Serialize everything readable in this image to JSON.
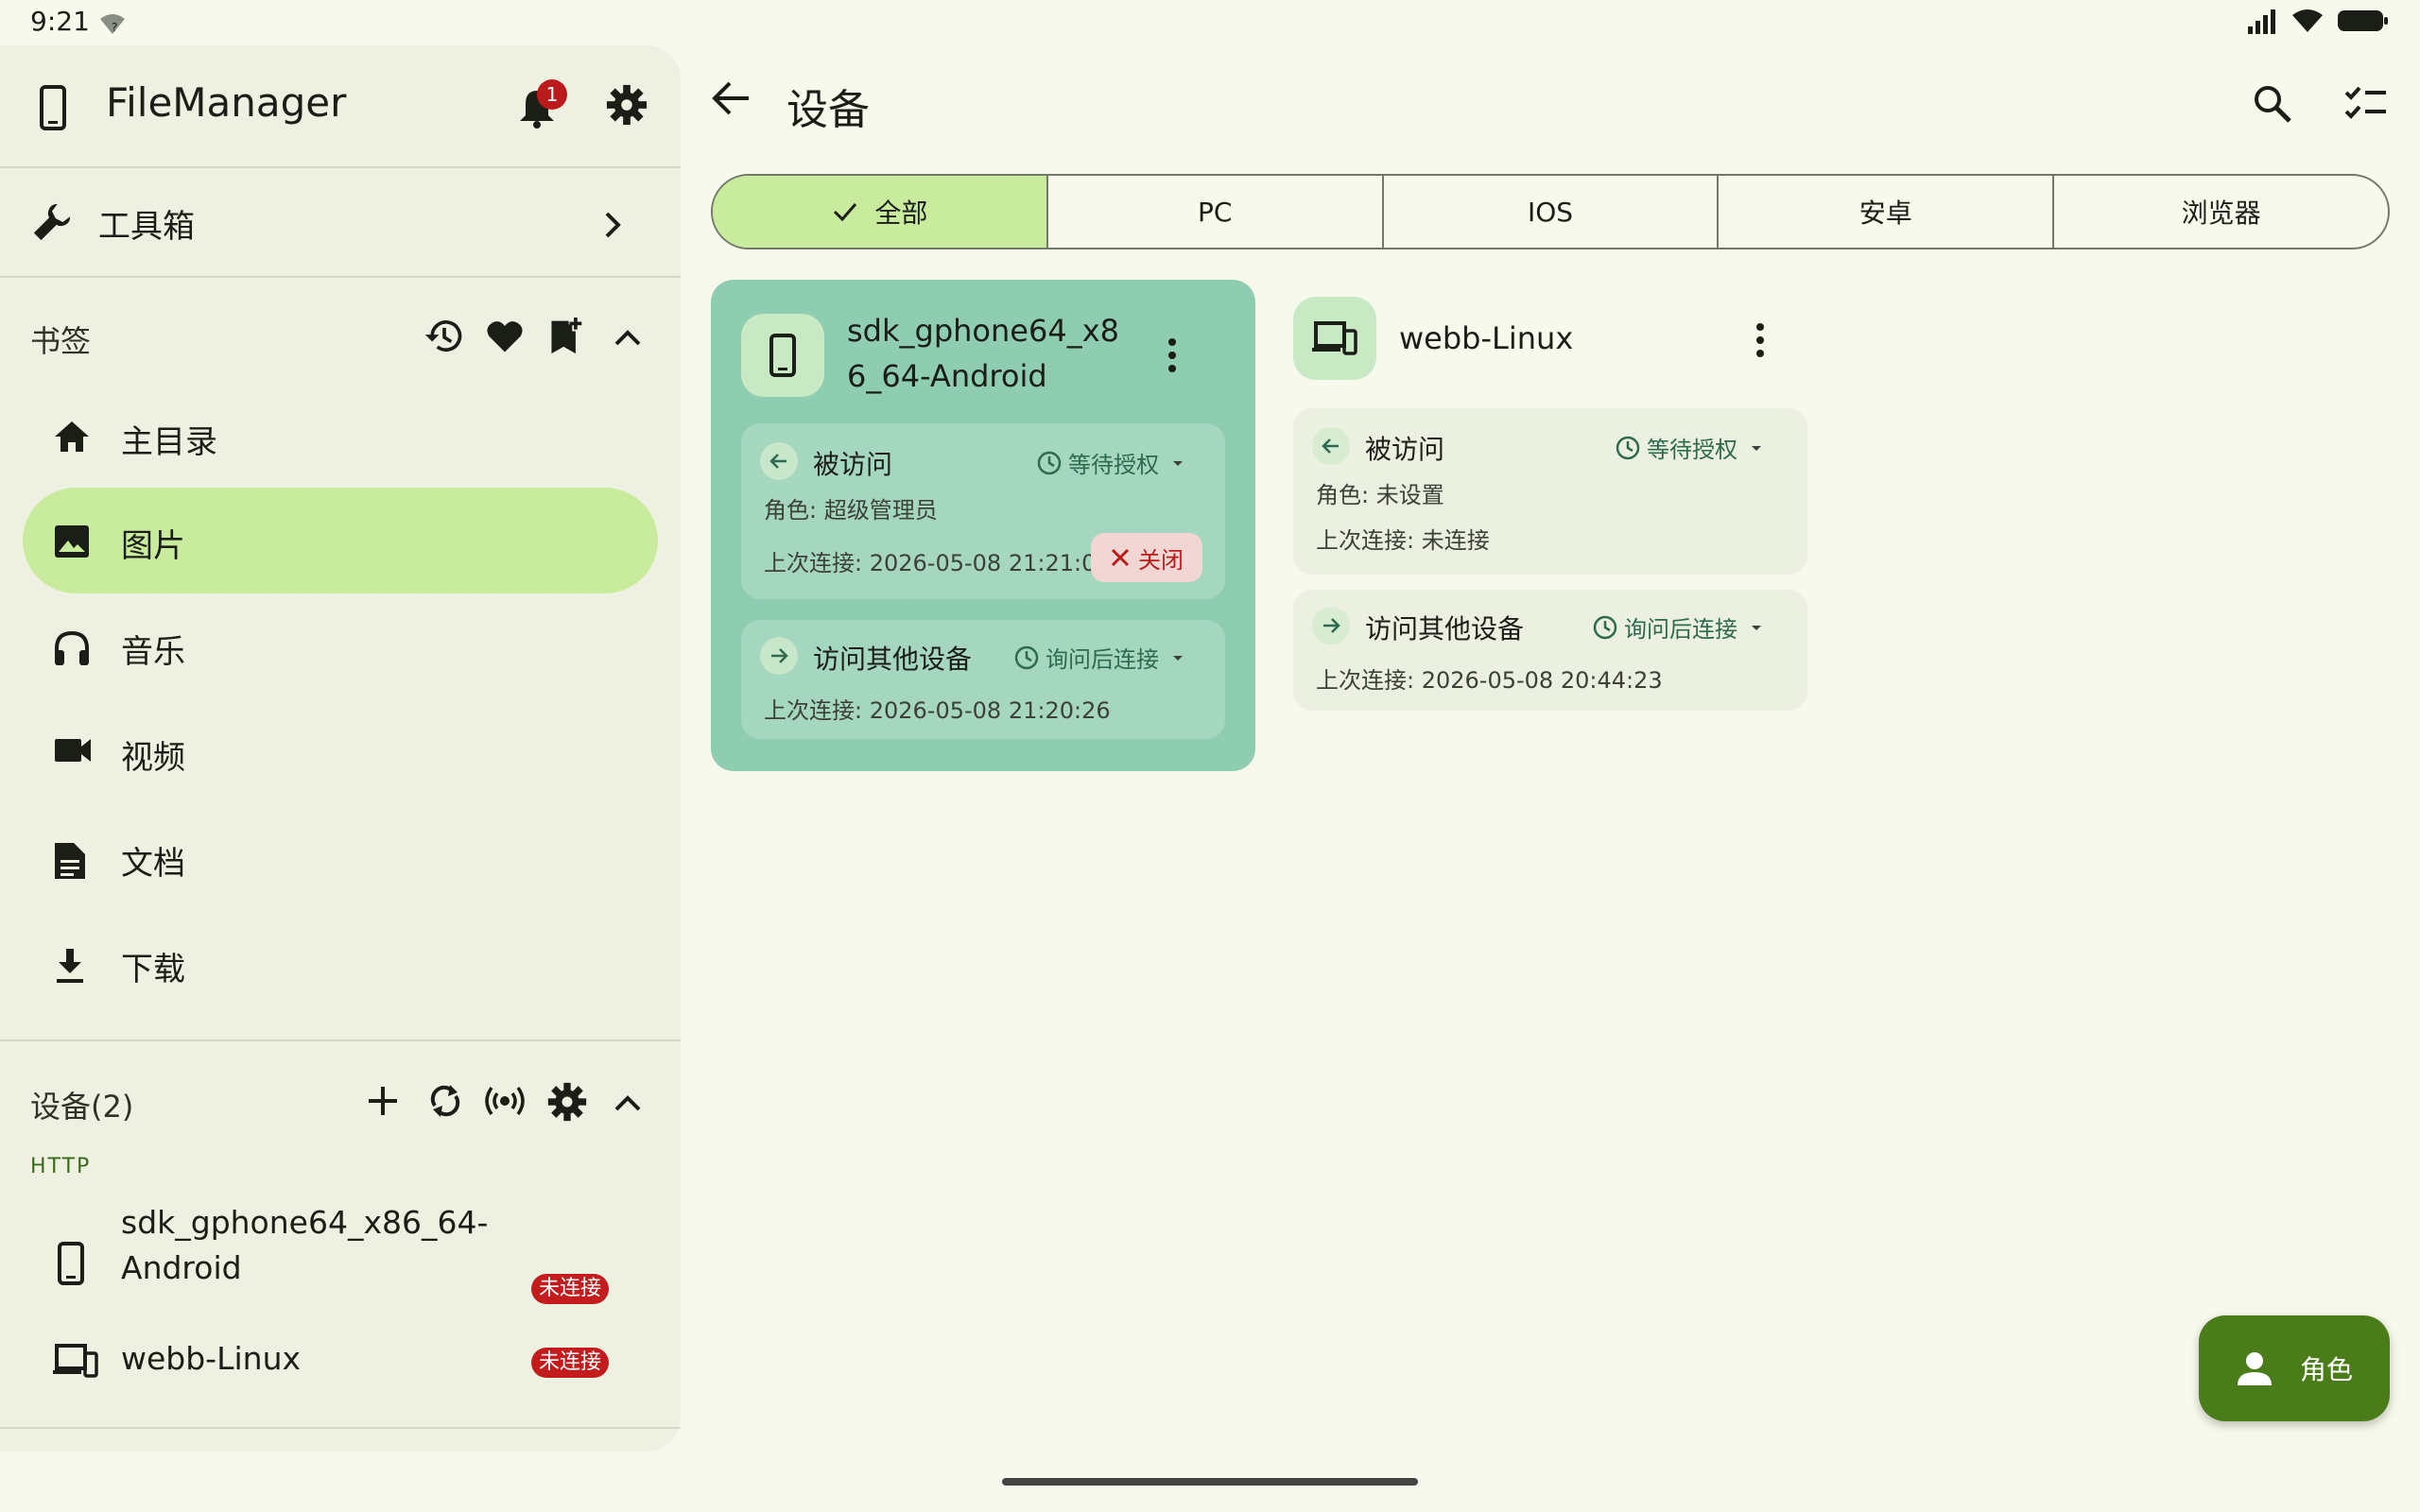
{
  "status": {
    "time": "9:21"
  },
  "app": {
    "title": "FileManager",
    "notification_count": "1"
  },
  "toolbox": {
    "label": "工具箱"
  },
  "bookmarks": {
    "title": "书签",
    "items": [
      {
        "label": "主目录",
        "icon": "home-icon"
      },
      {
        "label": "图片",
        "icon": "image-icon",
        "selected": true
      },
      {
        "label": "音乐",
        "icon": "headphones-icon"
      },
      {
        "label": "视频",
        "icon": "videocam-icon"
      },
      {
        "label": "文档",
        "icon": "document-icon"
      },
      {
        "label": "下载",
        "icon": "download-icon"
      }
    ]
  },
  "devices_section": {
    "title": "设备(2)",
    "group": "HTTP",
    "items": [
      {
        "label": "sdk_gphone64_x86_64-Android",
        "status": "未连接"
      },
      {
        "label": "webb-Linux",
        "status": "未连接"
      }
    ]
  },
  "main": {
    "title": "设备",
    "filters": [
      "全部",
      "PC",
      "IOS",
      "安卓",
      "浏览器"
    ],
    "active_filter": "全部",
    "cards": [
      {
        "name": "sdk_gphone64_x86_64-Android",
        "incoming": {
          "title": "被访问",
          "status": "等待授权",
          "role": "角色: 超级管理员",
          "last": "上次连接: 2026-05-08 21:21:01",
          "close": "关闭"
        },
        "outgoing": {
          "title": "访问其他设备",
          "status": "询问后连接",
          "last": "上次连接: 2026-05-08 21:20:26"
        }
      },
      {
        "name": "webb-Linux",
        "incoming": {
          "title": "被访问",
          "status": "等待授权",
          "role": "角色: 未设置",
          "last": "上次连接: 未连接"
        },
        "outgoing": {
          "title": "访问其他设备",
          "status": "询问后连接",
          "last": "上次连接: 2026-05-08 20:44:23"
        }
      }
    ],
    "fab_label": "角色"
  },
  "colors": {
    "accent": "#c8eb9d",
    "card_selected": "#8fcdb2",
    "badge_red": "#c21c1c",
    "fab": "#4a7c1a"
  }
}
